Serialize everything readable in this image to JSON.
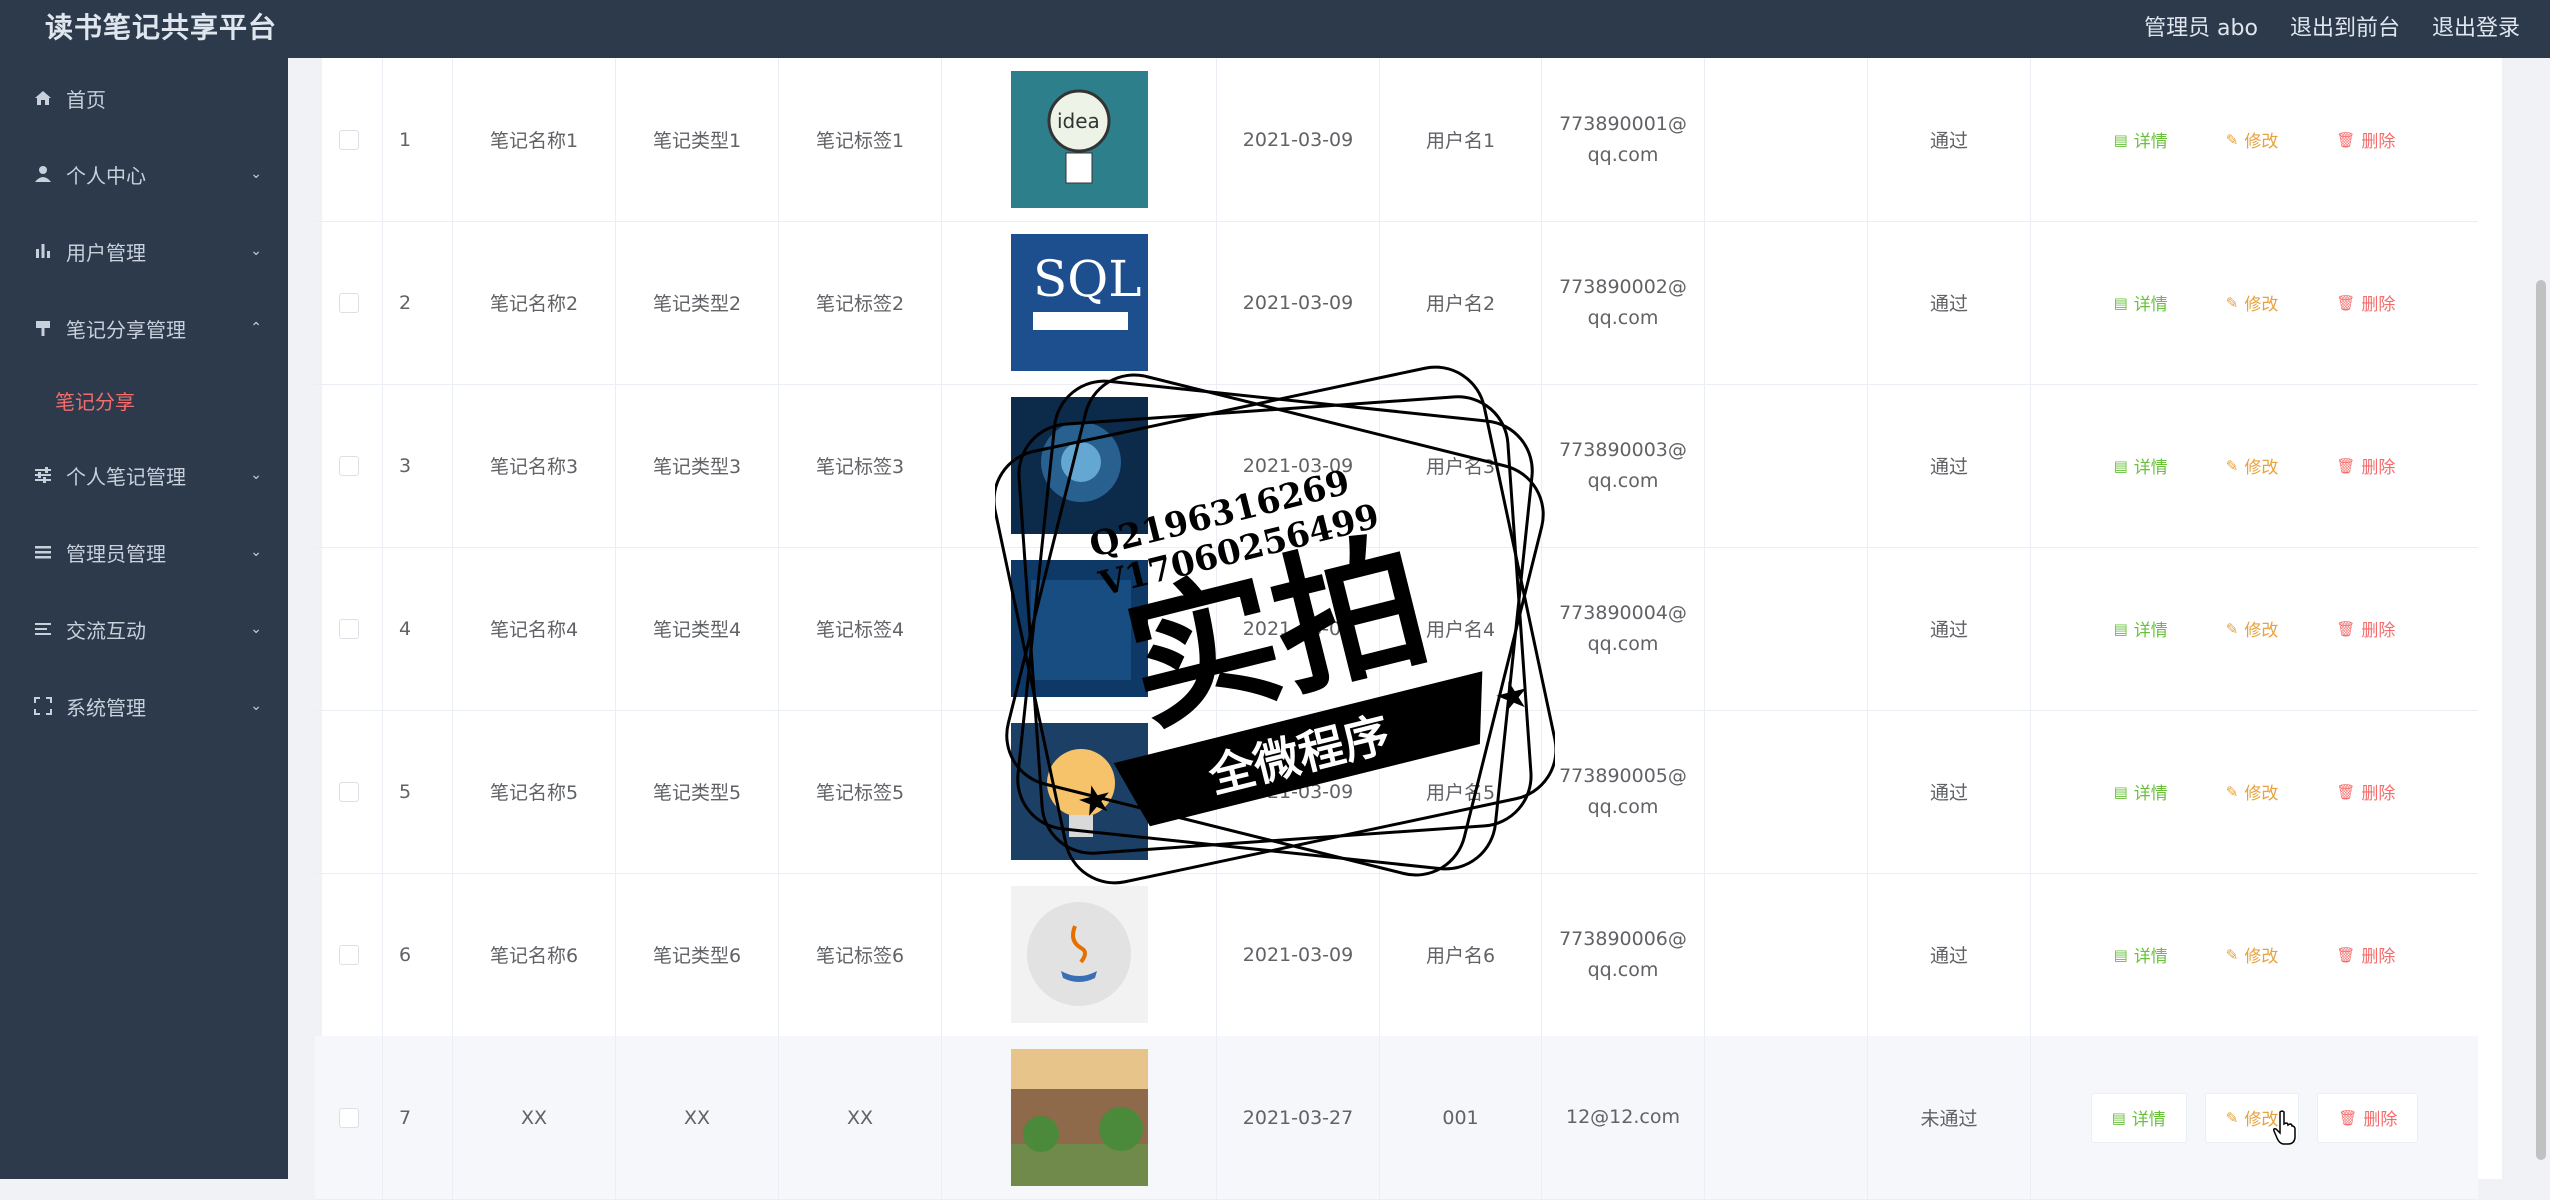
{
  "header": {
    "brand": "读书笔记共享平台",
    "admin": "管理员 abo",
    "to_front": "退出到前台",
    "logout": "退出登录"
  },
  "sidebar": {
    "items": [
      {
        "label": "首页",
        "icon": "home-icon"
      },
      {
        "label": "个人中心",
        "icon": "user-icon"
      },
      {
        "label": "用户管理",
        "icon": "chart-icon"
      },
      {
        "label": "笔记分享管理",
        "icon": "brush-icon"
      },
      {
        "label": "个人笔记管理",
        "icon": "sliders-icon"
      },
      {
        "label": "管理员管理",
        "icon": "list-icon"
      },
      {
        "label": "交流互动",
        "icon": "menu-icon"
      },
      {
        "label": "系统管理",
        "icon": "fullscreen-icon"
      }
    ],
    "sub_item": "笔记分享"
  },
  "table": {
    "rows": [
      {
        "idx": "1",
        "name": "笔记名称1",
        "type": "笔记类型1",
        "tag": "笔记标签1",
        "date": "2021-03-09",
        "user": "用户名1",
        "mail1": "773890001@",
        "mail2": "qq.com",
        "status": "通过",
        "image": "idea-bulb"
      },
      {
        "idx": "2",
        "name": "笔记名称2",
        "type": "笔记类型2",
        "tag": "笔记标签2",
        "date": "2021-03-09",
        "user": "用户名2",
        "mail1": "773890002@",
        "mail2": "qq.com",
        "status": "通过",
        "image": "sql-book"
      },
      {
        "idx": "3",
        "name": "笔记名称3",
        "type": "笔记类型3",
        "tag": "笔记标签3",
        "date": "2021-03-09",
        "user": "用户名3",
        "mail1": "773890003@",
        "mail2": "qq.com",
        "status": "通过",
        "image": "digital-head"
      },
      {
        "idx": "4",
        "name": "笔记名称4",
        "type": "笔记类型4",
        "tag": "笔记标签4",
        "date": "2021-03-09",
        "user": "用户名4",
        "mail1": "773890004@",
        "mail2": "qq.com",
        "status": "通过",
        "image": "blue-abstract"
      },
      {
        "idx": "5",
        "name": "笔记名称5",
        "type": "笔记类型5",
        "tag": "笔记标签5",
        "date": "2021-03-09",
        "user": "用户名5",
        "mail1": "773890005@",
        "mail2": "qq.com",
        "status": "通过",
        "image": "bulb-poster"
      },
      {
        "idx": "6",
        "name": "笔记名称6",
        "type": "笔记类型6",
        "tag": "笔记标签6",
        "date": "2021-03-09",
        "user": "用户名6",
        "mail1": "773890006@",
        "mail2": "qq.com",
        "status": "通过",
        "image": "java-logo"
      },
      {
        "idx": "7",
        "name": "XX",
        "type": "XX",
        "tag": "XX",
        "date": "2021-03-27",
        "user": "001",
        "mail1": "12@12.com",
        "mail2": "",
        "status": "未通过",
        "image": "campus-photo"
      }
    ],
    "actions": {
      "detail": "详情",
      "edit": "修改",
      "delete": "删除"
    }
  },
  "watermark": {
    "line1": "Q2196316269",
    "line2": "V17060256499",
    "big": "实拍",
    "banner": "全微程序"
  },
  "colors": {
    "sidebar_bg": "#2d3a4b",
    "active_sub": "#f56c6c",
    "detail": "#67c23a",
    "edit": "#e6a23c",
    "delete": "#f56c6c"
  }
}
